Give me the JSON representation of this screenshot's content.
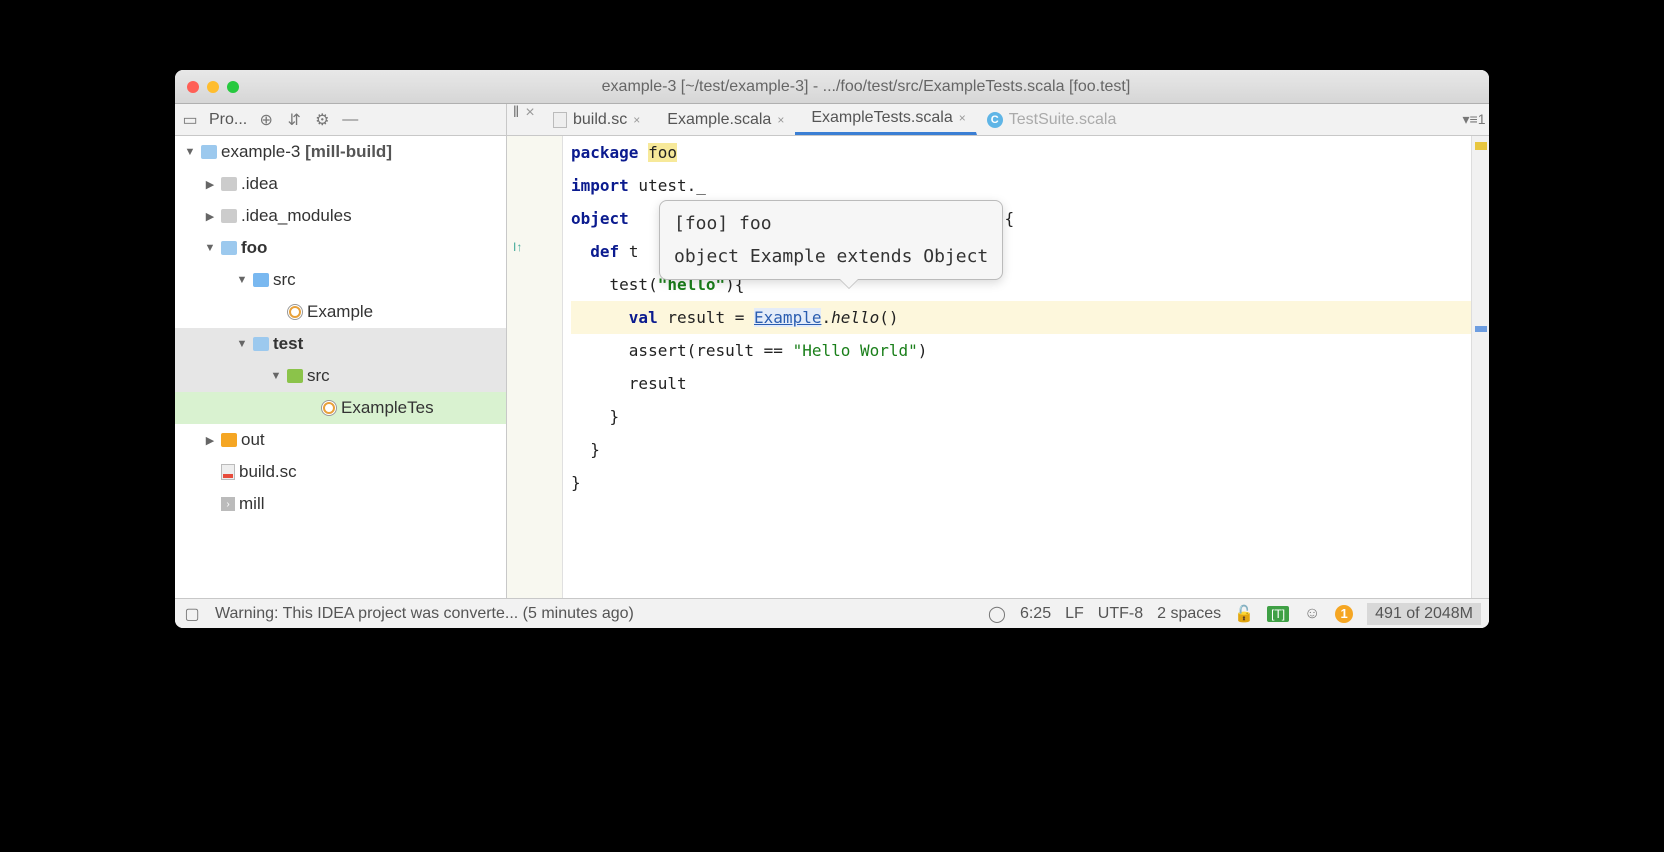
{
  "title": "example-3 [~/test/example-3] - .../foo/test/src/ExampleTests.scala [foo.test]",
  "project_label": "Pro...",
  "tabs": [
    {
      "label": "build.sc",
      "icon": "file",
      "active": false
    },
    {
      "label": "Example.scala",
      "icon": "scala",
      "active": false
    },
    {
      "label": "ExampleTests.scala",
      "icon": "scala",
      "active": true
    },
    {
      "label": "TestSuite.scala",
      "icon": "class",
      "active": false,
      "dim": true
    }
  ],
  "tree": {
    "root": "example-3",
    "root_tag": "[mill-build]",
    "items": [
      {
        "level": 1,
        "arrow": "right",
        "icon": "folder-grey",
        "label": ".idea"
      },
      {
        "level": 1,
        "arrow": "right",
        "icon": "folder-grey",
        "label": ".idea_modules"
      },
      {
        "level": 1,
        "arrow": "down",
        "icon": "folder-lblue",
        "label": "foo",
        "bold": true
      },
      {
        "level": 2,
        "arrow": "down",
        "icon": "folder-blue",
        "label": "src"
      },
      {
        "level": 3,
        "arrow": "",
        "icon": "scala",
        "label": "Example"
      },
      {
        "level": 2,
        "arrow": "down",
        "icon": "folder-lblue",
        "label": "test",
        "bold": true,
        "sel": "grey"
      },
      {
        "level": 3,
        "arrow": "down",
        "icon": "folder-green",
        "label": "src",
        "sel": "grey"
      },
      {
        "level": 4,
        "arrow": "",
        "icon": "scala",
        "label": "ExampleTes",
        "sel": "green"
      },
      {
        "level": 1,
        "arrow": "right",
        "icon": "folder-orange",
        "label": "out"
      },
      {
        "level": 1,
        "arrow": "",
        "icon": "file",
        "label": "build.sc"
      },
      {
        "level": 1,
        "arrow": "",
        "icon": "term",
        "label": "mill"
      }
    ]
  },
  "code": {
    "l1_pkg": "package",
    "l1_foo": "foo",
    "l2_imp": "import",
    "l2_rest": " utest._",
    "l3_obj": "object",
    "l3_after": "{",
    "l4_def": "def",
    "l4_rest": "t",
    "l5_pre": "    test(",
    "l5_hello": "\"hello\"",
    "l5_post": "){",
    "l6_val": "val",
    "l6_pre": " result = ",
    "l6_link": "Example",
    "l6_dot": ".",
    "l6_hello": "hello",
    "l6_post": "()",
    "l7": "      assert(result == ",
    "l7_str": "\"Hello World\"",
    "l7_post": ")",
    "l8": "      result",
    "l9": "    }",
    "l10": "  }",
    "l11": "}"
  },
  "tooltip": {
    "line1": "[foo] foo",
    "line2": "object Example extends Object"
  },
  "status": {
    "warning": "Warning: This IDEA project was converte... (5 minutes ago)",
    "pos": "6:25",
    "line_sep": "LF",
    "encoding": "UTF-8",
    "indent": "2 spaces",
    "tests_badge": "[T]",
    "notif_count": "1",
    "memory": "491 of 2048M"
  }
}
